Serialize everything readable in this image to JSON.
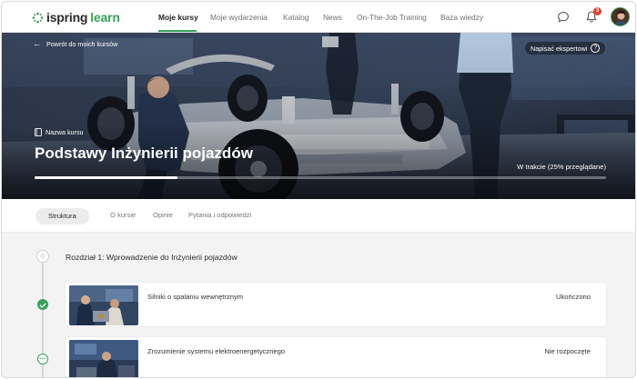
{
  "brand": {
    "name_part1": "ispring",
    "name_part2": "learn",
    "accent": "#36a35a"
  },
  "nav": {
    "items": [
      {
        "label": "Moje kursy",
        "active": true
      },
      {
        "label": "Moje wydarzenia",
        "active": false
      },
      {
        "label": "Katalog",
        "active": false
      },
      {
        "label": "News",
        "active": false
      },
      {
        "label": "On-The-Job Training",
        "active": false
      },
      {
        "label": "Baza wiedzy",
        "active": false
      }
    ],
    "notifications_count": "3",
    "icons": [
      "chat-icon",
      "bell-icon",
      "avatar"
    ]
  },
  "hero": {
    "back_label": "Powrót do moich kursów",
    "expert_label": "Napisać ekspertowi",
    "expert_icon": "?",
    "course_label": "Nazwa kursu",
    "course_title": "Podstawy Inżynierii pojazdów",
    "progress_status": "W trakcie (25% przeglądane)",
    "progress_fraction": 0.25
  },
  "tabs": [
    {
      "label": "Struktura",
      "active": true
    },
    {
      "label": "O kursie",
      "active": false
    },
    {
      "label": "Opinie",
      "active": false
    },
    {
      "label": "Pytania i odpowiedzi",
      "active": false
    }
  ],
  "chapter": {
    "title": "Rozdział 1: Wprowadzenie do Inżynierii pojazdów",
    "lessons": [
      {
        "name": "Silniki o spalaniu wewnętrznym",
        "status": "Ukończono",
        "state": "completed"
      },
      {
        "name": "Zrozumienie systemu elektroenergetycznego",
        "status": "Nie rozpoczęte",
        "state": "not-started"
      }
    ]
  }
}
